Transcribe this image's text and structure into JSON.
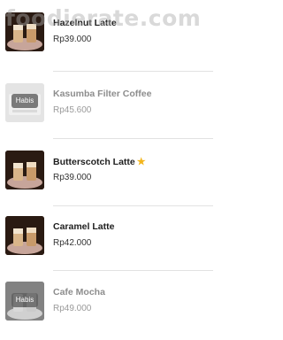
{
  "watermark": "foodierate.com",
  "menu": {
    "items": [
      {
        "name": "Hazelnut Latte",
        "price": "Rp39.000",
        "available": true,
        "featured": false,
        "photo": "iced-latte-photo"
      },
      {
        "name": "Kasumba Filter Coffee",
        "price": "Rp45.600",
        "available": false,
        "badge": "Habis",
        "featured": false,
        "photo": "filter-coffee-photo"
      },
      {
        "name": "Butterscotch Latte",
        "price": "Rp39.000",
        "available": true,
        "featured": true,
        "featured_icon": "star-icon",
        "photo": "iced-latte-photo"
      },
      {
        "name": "Caramel Latte",
        "price": "Rp42.000",
        "available": true,
        "featured": false,
        "photo": "iced-latte-photo"
      },
      {
        "name": "Cafe Mocha",
        "price": "Rp49.000",
        "available": false,
        "badge": "Habis",
        "featured": false,
        "photo": "iced-latte-photo"
      }
    ]
  },
  "colors": {
    "star": "#f3b51c",
    "badge_bg": "#5f5f5f",
    "divider": "#e2e2e2"
  }
}
